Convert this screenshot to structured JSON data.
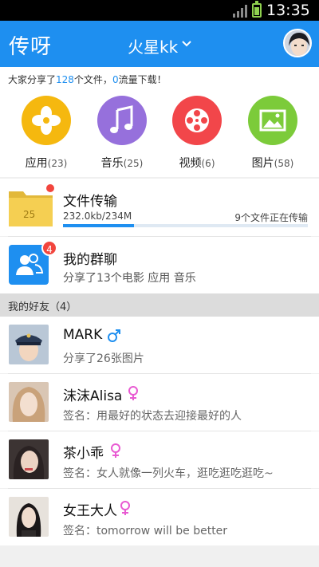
{
  "status_bar": {
    "time": "13:35"
  },
  "app_bar": {
    "logo": "传呀",
    "username": "火星kk"
  },
  "share_summary": {
    "prefix": "大家分享了",
    "files": "128",
    "middle": "个文件，",
    "traffic": "0",
    "suffix": "流量下载！"
  },
  "categories": [
    {
      "label": "应用",
      "count": "(23)",
      "color": "#f5b80f",
      "icon": "apps-icon"
    },
    {
      "label": "音乐",
      "count": "(25)",
      "color": "#9670dc",
      "icon": "music-note-icon"
    },
    {
      "label": "视频",
      "count": "(6)",
      "color": "#f2464a",
      "icon": "film-reel-icon"
    },
    {
      "label": "图片",
      "count": "(58)",
      "color": "#7ccb3a",
      "icon": "picture-icon"
    }
  ],
  "file_transfer": {
    "title": "文件传输",
    "folder_label": "25",
    "size": "232.0kb/234M",
    "status": "9个文件正在传输",
    "progress": 0.29
  },
  "group_chat": {
    "title": "我的群聊",
    "badge": "4",
    "subtitle": "分享了13个电影 应用 音乐"
  },
  "friends_section": {
    "label": "我的好友（4）"
  },
  "friends": [
    {
      "name": "MARK",
      "gender": "male",
      "subtitle": "分享了26张图片"
    },
    {
      "name": "沫沫Alisa",
      "gender": "female",
      "subtitle": "签名：用最好的状态去迎接最好的人"
    },
    {
      "name": "茶小乖",
      "gender": "female",
      "subtitle": "签名：女人就像一列火车，逛吃逛吃逛吃~"
    },
    {
      "name": "女王大人",
      "gender": "female",
      "subtitle": "签名：tomorrow will be better"
    }
  ],
  "colors": {
    "primary": "#1e8ff0",
    "male": "#1e8ff0",
    "female": "#e85ad2",
    "badge": "#f2453d"
  }
}
